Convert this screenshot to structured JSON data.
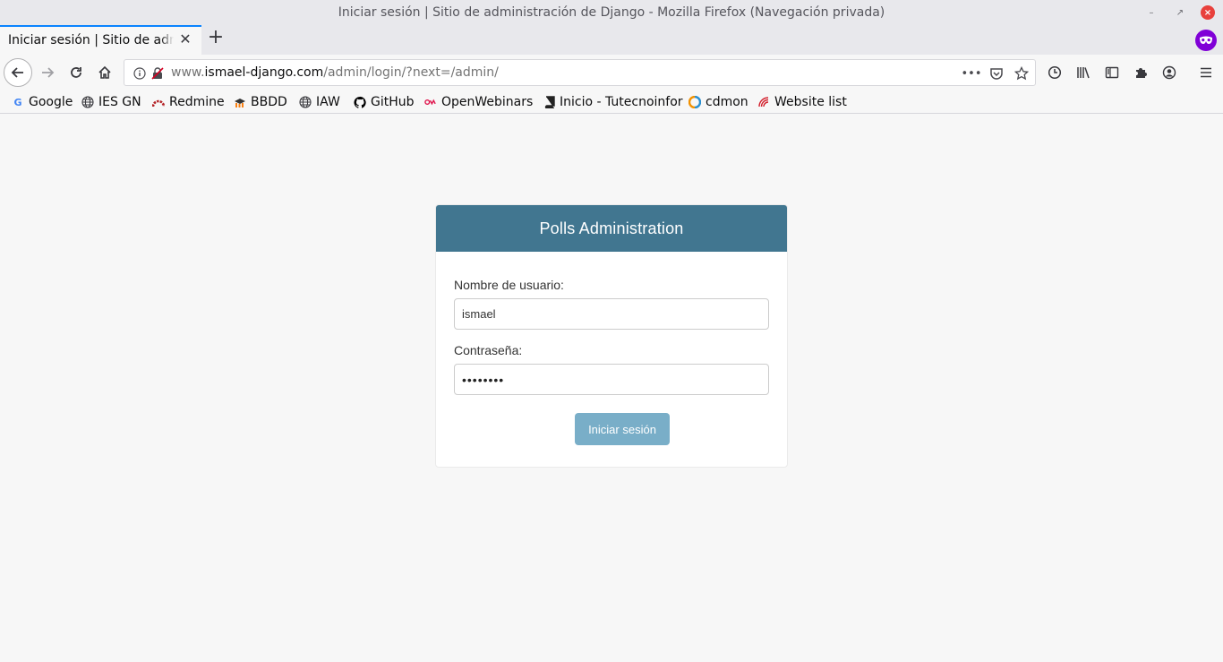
{
  "window": {
    "title": "Iniciar sesión | Sitio de administración de Django - Mozilla Firefox (Navegación privada)"
  },
  "tabs": [
    {
      "title": "Iniciar sesión | Sitio de administración de Django"
    }
  ],
  "urlbar": {
    "prefix": "www.",
    "host": "ismael-django.com",
    "path": "/admin/login/?next=/admin/"
  },
  "bookmarks": [
    {
      "label": "Google",
      "icon": "google-icon",
      "color": "#4285f4"
    },
    {
      "label": "IES GN",
      "icon": "globe-icon",
      "color": "#38383d"
    },
    {
      "label": "Redmine",
      "icon": "redmine-icon",
      "color": "#b32024"
    },
    {
      "label": "BBDD",
      "icon": "moodle-icon",
      "color": "#f98012"
    },
    {
      "label": "IAW",
      "icon": "globe-icon",
      "color": "#38383d"
    },
    {
      "label": "GitHub",
      "icon": "github-icon",
      "color": "#000000"
    },
    {
      "label": "OpenWebinars",
      "icon": "openwebinars-icon",
      "color": "#e0144c"
    },
    {
      "label": "Inicio - Tutecnoinfor",
      "icon": "book-icon",
      "color": "#222222"
    },
    {
      "label": "cdmon",
      "icon": "cdmon-icon",
      "color": "#f29100"
    },
    {
      "label": "Website list",
      "icon": "website-list-icon",
      "color": "#d21e2b"
    }
  ],
  "login": {
    "header": "Polls Administration",
    "username_label": "Nombre de usuario:",
    "username_value": "ismael",
    "password_label": "Contraseña:",
    "password_value": "••••••••",
    "submit_label": "Iniciar sesión"
  },
  "colors": {
    "header_bg": "#417690",
    "button_bg": "#79aec8",
    "page_bg": "#f7f7f7",
    "private_badge": "#8000d7"
  }
}
